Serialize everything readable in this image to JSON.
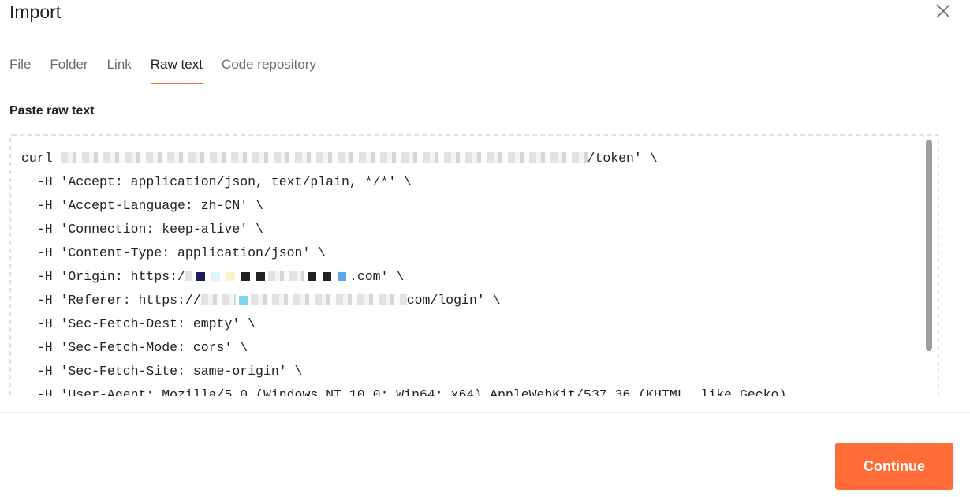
{
  "dialog": {
    "title": "Import"
  },
  "tabs": [
    {
      "label": "File",
      "active": false
    },
    {
      "label": "Folder",
      "active": false
    },
    {
      "label": "Link",
      "active": false
    },
    {
      "label": "Raw text",
      "active": true
    },
    {
      "label": "Code repository",
      "active": false
    }
  ],
  "section_label": "Paste raw text",
  "raw_text": {
    "lines": {
      "l1_start": "curl ",
      "l1_end": "/token' \\",
      "l2": "  -H 'Accept: application/json, text/plain, */*' \\",
      "l3": "  -H 'Accept-Language: zh-CN' \\",
      "l4": "  -H 'Connection: keep-alive' \\",
      "l5": "  -H 'Content-Type: application/json' \\",
      "l6_start": "  -H 'Origin: https:/",
      "l6_end": ".com' \\",
      "l7_start": "  -H 'Referer: https://",
      "l7_end": "com/login' \\",
      "l8": "  -H 'Sec-Fetch-Dest: empty' \\",
      "l9": "  -H 'Sec-Fetch-Mode: cors' \\",
      "l10": "  -H 'Sec-Fetch-Site: same-origin' \\",
      "l11": "  -H 'User-Agent: Mozilla/5.0 (Windows NT 10.0; Win64; x64) AppleWebKit/537.36 (KHTML, like Gecko)"
    }
  },
  "footer": {
    "continue_label": "Continue"
  },
  "colors": {
    "accent": "#ff6c37",
    "text": "#212121",
    "muted": "#6b6b6b"
  },
  "icons": {
    "close": "close-icon"
  }
}
